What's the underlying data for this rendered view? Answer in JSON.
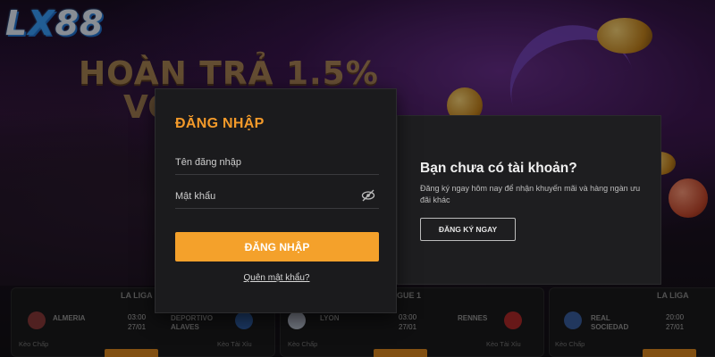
{
  "brand": {
    "logo_prefix": "L",
    "logo_x": "X",
    "logo_suffix": "88"
  },
  "banner": {
    "line1": "HOÀN TRẢ 1.5%",
    "line2": "VÔ"
  },
  "login": {
    "title": "ĐĂNG NHẬP",
    "username_placeholder": "Tên đăng nhập",
    "password_placeholder": "Mật khẩu",
    "submit_label": "ĐĂNG NHẬP",
    "forgot_label": "Quên mật khẩu?"
  },
  "register": {
    "title": "Bạn chưa có tài khoản?",
    "description": "Đăng ký ngay hôm nay để nhận khuyến mãi và hàng ngàn ưu đãi khác",
    "button_label": "ĐĂNG KÝ NGAY"
  },
  "matches": [
    {
      "league": "LA LIGA",
      "home": "ALMERIA",
      "away": "DEPORTIVO ALAVES",
      "time": "03:00",
      "date": "27/01",
      "left_label": "Kèo Chấp",
      "right_label": "Kèo Tài Xỉu"
    },
    {
      "league": "LIGUE 1",
      "home": "LYON",
      "away": "RENNES",
      "time": "03:00",
      "date": "27/01",
      "left_label": "Kèo Chấp",
      "right_label": "Kèo Tài Xỉu"
    },
    {
      "league": "LA LIGA",
      "home": "REAL SOCIEDAD",
      "away": "",
      "time": "20:00",
      "date": "27/01",
      "left_label": "Kèo Chấp",
      "right_label": ""
    }
  ],
  "colors": {
    "accent": "#f4a12b",
    "title_accent": "#f39a2a",
    "panel": "#1b1b1d"
  },
  "icons": {
    "password_toggle": "eye-off-icon"
  }
}
